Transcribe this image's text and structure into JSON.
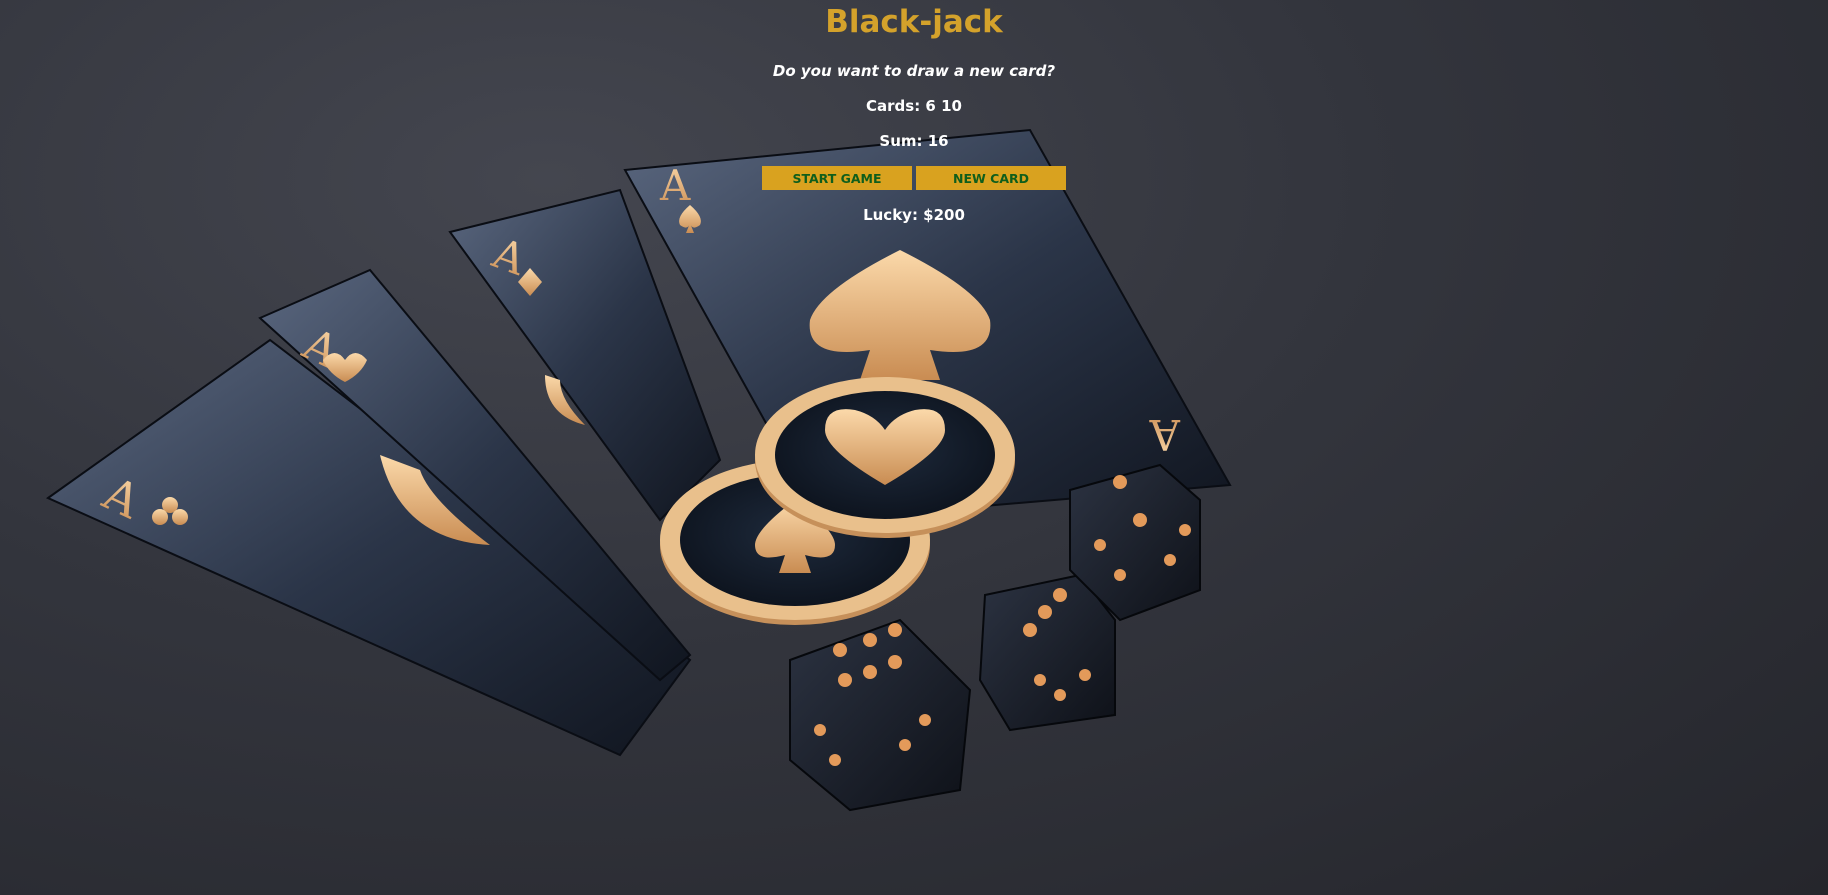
{
  "game": {
    "title": "Black-jack",
    "prompt": "Do you want to draw a new card?",
    "cards_label": "Cards: 6 10",
    "sum_label": "Sum: 16",
    "lucky_label": "Lucky: $200"
  },
  "buttons": {
    "start_label": "START GAME",
    "new_card_label": "NEW CARD"
  },
  "background": {
    "card_ranks": [
      "A",
      "A",
      "A",
      "A"
    ],
    "card_suits": [
      "club",
      "heart",
      "diamond",
      "spade"
    ],
    "chip_suits": [
      "heart",
      "spade"
    ],
    "dice_faces": [
      6,
      3,
      5
    ],
    "colors": {
      "accent_gold": "#d4a22b",
      "button_bg": "#d9a21f",
      "button_text": "#0f5e1b",
      "card_dark": "#1c2535",
      "gold_glow": "#f0c48e"
    }
  }
}
